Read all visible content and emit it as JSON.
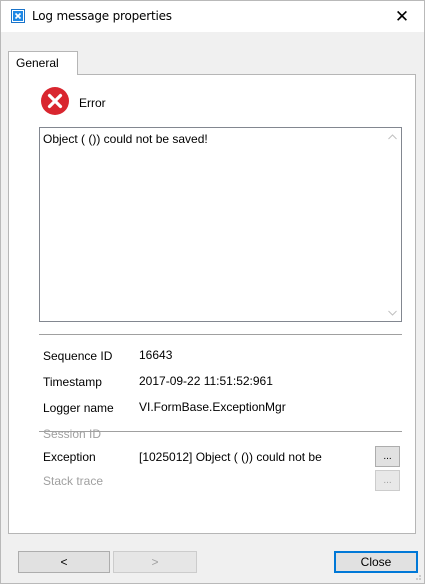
{
  "window": {
    "title": "Log message properties",
    "close_glyph": "✕",
    "icon": "log-window-icon"
  },
  "tabs": [
    {
      "label": "General",
      "selected": true
    }
  ],
  "message": {
    "level_icon": "error-icon",
    "level": "Error",
    "text": "Object ( ()) could not be saved!"
  },
  "details": {
    "sequence_id_label": "Sequence ID",
    "sequence_id": "16643",
    "timestamp_label": "Timestamp",
    "timestamp": "2017-09-22 11:51:52:961",
    "logger_label": "Logger name",
    "logger": "VI.FormBase.ExceptionMgr"
  },
  "extra": {
    "session_label": "Session ID",
    "exception_label": "Exception",
    "exception_value": "[1025012] Object ( ()) could not be",
    "stack_label": "Stack trace",
    "ellipsis": "..."
  },
  "buttons": {
    "prev": "<",
    "next": ">",
    "close": "Close"
  },
  "colors": {
    "error_red": "#d9262f",
    "accent_blue": "#0078d7"
  }
}
